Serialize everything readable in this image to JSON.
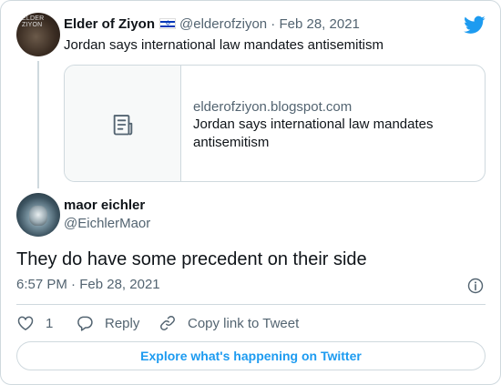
{
  "parent_tweet": {
    "avatar_logo_text": "ELDER ZIYON",
    "author_name": "Elder of Ziyon",
    "flag_icon": "israel-flag-icon",
    "handle": "@elderofziyon",
    "separator": "·",
    "date": "Feb 28, 2021",
    "text": "Jordan says international law mandates antisemitism",
    "link_card": {
      "thumb_icon": "document-icon",
      "domain": "elderofziyon.blogspot.com",
      "title": "Jordan says international law mandates antisemitism"
    }
  },
  "main_tweet": {
    "author_name": "maor eichler",
    "handle": "@EichlerMaor",
    "text": "They do have some precedent on their side",
    "time": "6:57 PM",
    "separator": "·",
    "date": "Feb 28, 2021"
  },
  "actions": {
    "like_count": "1",
    "reply_label": "Reply",
    "copy_link_label": "Copy link to Tweet"
  },
  "explore_button": "Explore what's happening on Twitter",
  "colors": {
    "brand_blue": "#1d9bf0",
    "text_primary": "#0f1419",
    "text_secondary": "#536471",
    "border": "#cfd9de"
  }
}
